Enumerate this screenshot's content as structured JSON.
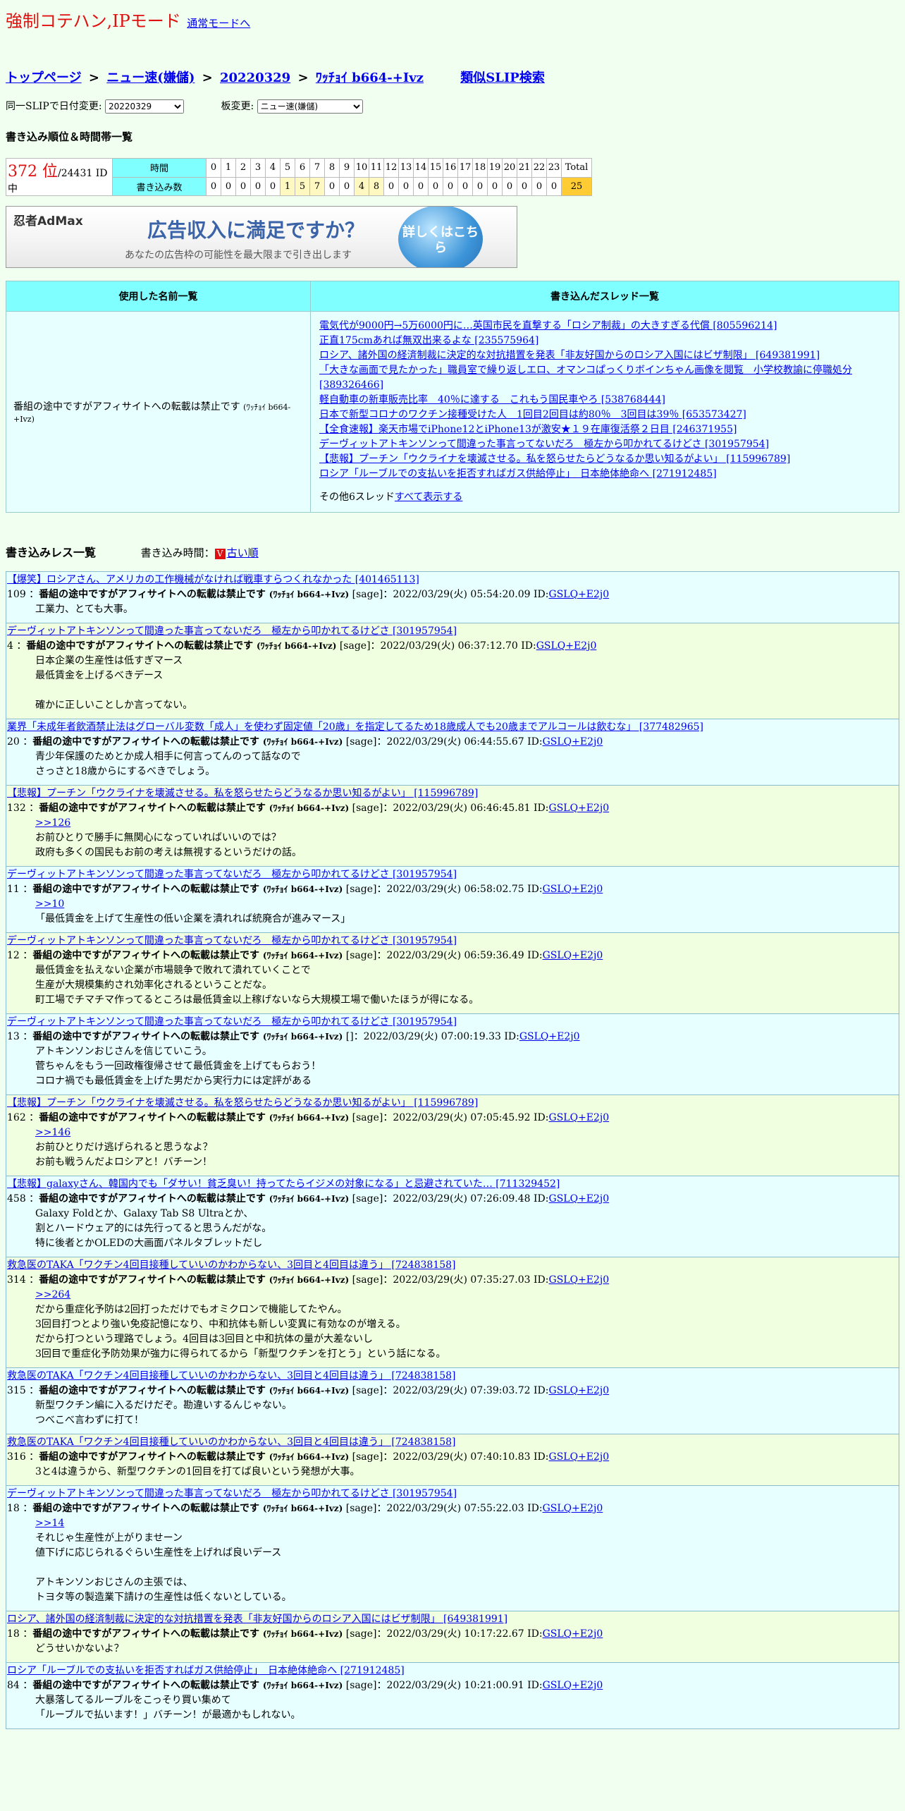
{
  "header": {
    "mode_title": "強制コテハン,IPモード",
    "normal_mode_link": "通常モードへ"
  },
  "breadcrumb": {
    "top": "トップページ",
    "board": "ニュー速(嫌儲)",
    "date": "20220329",
    "slip": "ﾜｯﾁｮｲ b664-+Ivz",
    "similar": "類似SLIP検索",
    "sep": ">"
  },
  "controls": {
    "date_change_label": "同一SLIPで日付変更:",
    "date_value": "20220329",
    "board_change_label": "板変更:",
    "board_value": "ニュー速(嫌儲)"
  },
  "ranking": {
    "heading": "書き込み順位＆時間帯一覧",
    "rank": "372 位",
    "id_total": "/24431 ID中",
    "time_label": "時間",
    "count_label": "書き込み数",
    "hours": [
      "0",
      "1",
      "2",
      "3",
      "4",
      "5",
      "6",
      "7",
      "8",
      "9",
      "10",
      "11",
      "12",
      "13",
      "14",
      "15",
      "16",
      "17",
      "18",
      "19",
      "20",
      "21",
      "22",
      "23",
      "Total"
    ],
    "counts": [
      "0",
      "0",
      "0",
      "0",
      "0",
      "1",
      "5",
      "7",
      "0",
      "0",
      "4",
      "8",
      "0",
      "0",
      "0",
      "0",
      "0",
      "0",
      "0",
      "0",
      "0",
      "0",
      "0",
      "0",
      "25"
    ]
  },
  "ad": {
    "logo": "忍者AdMax",
    "headline": "広告収入に満足ですか？",
    "sub": "あなたの広告枠の可能性を最大限まで引き出します",
    "button": "詳しくはこちら"
  },
  "usage": {
    "names_header": "使用した名前一覧",
    "threads_header": "書き込んだスレッド一覧",
    "name": "番組の途中ですがアフィサイトへの転載は禁止です",
    "name_slip": "(ﾜｯﾁｮｲ b664-+Ivz)",
    "threads": [
      "電気代が9000円→5万6000円に…英国市民を直撃する「ロシア制裁」の大きすぎる代償 [805596214]",
      "正直175cmあれば無双出来るよな [235575964]",
      "ロシア、諸外国の経済制裁に決定的な対抗措置を発表「非友好国からのロシア入国にはビザ制限」 [649381991]",
      "「大きな画面で見たかった」職員室で繰り返しエロ、オマンコぱっくりボインちゃん画像を閲覧　小学校教諭に停職処分 [389326466]",
      "軽自動車の新車販売比率　40％に達する　これもう国民車やろ [538768444]",
      "日本で新型コロナのワクチン接種受けた人　1回目2回目は約80％　3回目は39％ [653573427]",
      "【全食速報】楽天市場でiPhone12とiPhone13が激安★１９在庫復活祭２日目 [246371955]",
      "デーヴィットアトキンソンって間違った事言ってないだろ　極左から叩かれてるけどさ [301957954]",
      "【悲報】プーチン「ウクライナを壊滅させる。私を怒らせたらどうなるか思い知るがよい」 [115996789]",
      "ロシア「ルーブルでの支払いを拒否すればガス供給停止」　日本絶体絶命へ [271912485]"
    ],
    "more_prefix": "その他6スレッド",
    "more_link": "すべて表示する"
  },
  "posts_header": {
    "title": "書き込みレス一覧",
    "order_label": "書き込み時間：",
    "order_icon": "V",
    "order_link": "古い順"
  },
  "posts": [
    {
      "thread": "【爆笑】ロシアさん、アメリカの工作機械がなければ戦車すらつくれなかった [401465113]",
      "num": "109",
      "name": "番組の途中ですがアフィサイトへの転載は禁止です",
      "slip": "(ﾜｯﾁｮｲ b664-+Ivz)",
      "mail": "[sage]",
      "date": "：2022/03/29(火) 05:54:20.09",
      "id_label": "ID:",
      "id": "GSLQ+E2j0",
      "lines": [
        "工業力、とても大事。"
      ]
    },
    {
      "thread": "デーヴィットアトキンソンって間違った事言ってないだろ　極左から叩かれてるけどさ [301957954]",
      "num": "4",
      "name": "番組の途中ですがアフィサイトへの転載は禁止です",
      "slip": "(ﾜｯﾁｮｲ b664-+Ivz)",
      "mail": "[sage]",
      "date": "：2022/03/29(火) 06:37:12.70",
      "id_label": "ID:",
      "id": "GSLQ+E2j0",
      "lines": [
        "日本企業の生産性は低すぎマース",
        "最低賃金を上げるべきデース",
        "",
        "確かに正しいことしか言ってない。"
      ]
    },
    {
      "thread": "業界「未成年者飲酒禁止法はグローバル変数「成人」を使わず固定値「20歳」を指定してるため18歳成人でも20歳までアルコールは飲むな」 [377482965]",
      "num": "20",
      "name": "番組の途中ですがアフィサイトへの転載は禁止です",
      "slip": "(ﾜｯﾁｮｲ b664-+Ivz)",
      "mail": "[sage]",
      "date": "：2022/03/29(火) 06:44:55.67",
      "id_label": "ID:",
      "id": "GSLQ+E2j0",
      "lines": [
        "青少年保護のためとか成人相手に何言ってんのって話なので",
        "さっさと18歳からにするべきでしょう。"
      ]
    },
    {
      "thread": "【悲報】プーチン「ウクライナを壊滅させる。私を怒らせたらどうなるか思い知るがよい」 [115996789]",
      "num": "132",
      "name": "番組の途中ですがアフィサイトへの転載は禁止です",
      "slip": "(ﾜｯﾁｮｲ b664-+Ivz)",
      "mail": "[sage]",
      "date": "：2022/03/29(火) 06:46:45.81",
      "id_label": "ID:",
      "id": "GSLQ+E2j0",
      "anchor": ">>126",
      "lines": [
        "お前ひとりで勝手に無関心になっていればいいのでは？",
        "政府も多くの国民もお前の考えは無視するというだけの話。"
      ]
    },
    {
      "thread": "デーヴィットアトキンソンって間違った事言ってないだろ　極左から叩かれてるけどさ [301957954]",
      "num": "11",
      "name": "番組の途中ですがアフィサイトへの転載は禁止です",
      "slip": "(ﾜｯﾁｮｲ b664-+Ivz)",
      "mail": "[sage]",
      "date": "：2022/03/29(火) 06:58:02.75",
      "id_label": "ID:",
      "id": "GSLQ+E2j0",
      "anchor": ">>10",
      "lines": [
        "「最低賃金を上げて生産性の低い企業を潰れれば統廃合が進みマース」"
      ]
    },
    {
      "thread": "デーヴィットアトキンソンって間違った事言ってないだろ　極左から叩かれてるけどさ [301957954]",
      "num": "12",
      "name": "番組の途中ですがアフィサイトへの転載は禁止です",
      "slip": "(ﾜｯﾁｮｲ b664-+Ivz)",
      "mail": "[sage]",
      "date": "：2022/03/29(火) 06:59:36.49",
      "id_label": "ID:",
      "id": "GSLQ+E2j0",
      "lines": [
        "最低賃金を払えない企業が市場競争で敗れて潰れていくことで",
        "生産が大規模集約され効率化されるということだな。",
        "町工場でチマチマ作ってるところは最低賃金以上稼げないなら大規模工場で働いたほうが得になる。"
      ]
    },
    {
      "thread": "デーヴィットアトキンソンって間違った事言ってないだろ　極左から叩かれてるけどさ [301957954]",
      "num": "13",
      "name": "番組の途中ですがアフィサイトへの転載は禁止です",
      "slip": "(ﾜｯﾁｮｲ b664-+Ivz)",
      "mail": "[]",
      "date": "：2022/03/29(火) 07:00:19.33",
      "id_label": "ID:",
      "id": "GSLQ+E2j0",
      "lines": [
        "アトキンソンおじさんを信じていこう。",
        "菅ちゃんをもう一回政権復帰させて最低賃金を上げてもらおう！",
        "コロナ禍でも最低賃金を上げた男だから実行力には定評がある"
      ]
    },
    {
      "thread": "【悲報】プーチン「ウクライナを壊滅させる。私を怒らせたらどうなるか思い知るがよい」 [115996789]",
      "num": "162",
      "name": "番組の途中ですがアフィサイトへの転載は禁止です",
      "slip": "(ﾜｯﾁｮｲ b664-+Ivz)",
      "mail": "[sage]",
      "date": "：2022/03/29(火) 07:05:45.92",
      "id_label": "ID:",
      "id": "GSLQ+E2j0",
      "anchor": ">>146",
      "lines": [
        "お前ひとりだけ逃げられると思うなよ？",
        "お前も戦うんだよロシアと！バチーン！"
      ]
    },
    {
      "thread": "【悲報】galaxyさん、韓国内でも「ダサい！貧乏臭い！持ってたらイジメの対象になる」と忌避されていた… [711329452]",
      "num": "458",
      "name": "番組の途中ですがアフィサイトへの転載は禁止です",
      "slip": "(ﾜｯﾁｮｲ b664-+Ivz)",
      "mail": "[sage]",
      "date": "：2022/03/29(火) 07:26:09.48",
      "id_label": "ID:",
      "id": "GSLQ+E2j0",
      "lines": [
        "Galaxy Foldとか、Galaxy Tab S8 Ultraとか、",
        "割とハードウェア的には先行ってると思うんだがな。",
        "特に後者とかOLEDの大画面パネルタブレットだし"
      ]
    },
    {
      "thread": "救急医のTAKA「ワクチン4回目接種していいのかわからない、3回目と4回目は違う」 [724838158]",
      "num": "314",
      "name": "番組の途中ですがアフィサイトへの転載は禁止です",
      "slip": "(ﾜｯﾁｮｲ b664-+Ivz)",
      "mail": "[sage]",
      "date": "：2022/03/29(火) 07:35:27.03",
      "id_label": "ID:",
      "id": "GSLQ+E2j0",
      "anchor": ">>264",
      "lines": [
        "だから重症化予防は2回打っただけでもオミクロンで機能してたやん。",
        "3回目打つとより強い免疫記憶になり、中和抗体も新しい変異に有効なのが増える。",
        "だから打つという理路でしょう。4回目は3回目と中和抗体の量が大差ないし",
        "3回目で重症化予防効果が強力に得られてるから「新型ワクチンを打とう」という話になる。"
      ]
    },
    {
      "thread": "救急医のTAKA「ワクチン4回目接種していいのかわからない、3回目と4回目は違う」 [724838158]",
      "num": "315",
      "name": "番組の途中ですがアフィサイトへの転載は禁止です",
      "slip": "(ﾜｯﾁｮｲ b664-+Ivz)",
      "mail": "[sage]",
      "date": "：2022/03/29(火) 07:39:03.72",
      "id_label": "ID:",
      "id": "GSLQ+E2j0",
      "lines": [
        "新型ワクチン編に入るだけだぞ。勘違いするんじゃない。",
        "つべこべ言わずに打て！"
      ]
    },
    {
      "thread": "救急医のTAKA「ワクチン4回目接種していいのかわからない、3回目と4回目は違う」 [724838158]",
      "num": "316",
      "name": "番組の途中ですがアフィサイトへの転載は禁止です",
      "slip": "(ﾜｯﾁｮｲ b664-+Ivz)",
      "mail": "[sage]",
      "date": "：2022/03/29(火) 07:40:10.83",
      "id_label": "ID:",
      "id": "GSLQ+E2j0",
      "lines": [
        "3と4は違うから、新型ワクチンの1回目を打てば良いという発想が大事。"
      ]
    },
    {
      "thread": "デーヴィットアトキンソンって間違った事言ってないだろ　極左から叩かれてるけどさ [301957954]",
      "num": "18",
      "name": "番組の途中ですがアフィサイトへの転載は禁止です",
      "slip": "(ﾜｯﾁｮｲ b664-+Ivz)",
      "mail": "[sage]",
      "date": "：2022/03/29(火) 07:55:22.03",
      "id_label": "ID:",
      "id": "GSLQ+E2j0",
      "anchor": ">>14",
      "lines": [
        "それじゃ生産性が上がりませーン",
        "値下げに応じられるぐらい生産性を上げれば良いデース",
        "",
        "アトキンソンおじさんの主張では、",
        "トヨタ等の製造業下請けの生産性は低くないとしている。"
      ]
    },
    {
      "thread": "ロシア、諸外国の経済制裁に決定的な対抗措置を発表「非友好国からのロシア入国にはビザ制限」 [649381991]",
      "num": "18",
      "name": "番組の途中ですがアフィサイトへの転載は禁止です",
      "slip": "(ﾜｯﾁｮｲ b664-+Ivz)",
      "mail": "[sage]",
      "date": "：2022/03/29(火) 10:17:22.67",
      "id_label": "ID:",
      "id": "GSLQ+E2j0",
      "lines": [
        "どうせいかないよ？"
      ]
    },
    {
      "thread": "ロシア「ルーブルでの支払いを拒否すればガス供給停止」　日本絶体絶命へ [271912485]",
      "num": "84",
      "name": "番組の途中ですがアフィサイトへの転載は禁止です",
      "slip": "(ﾜｯﾁｮｲ b664-+Ivz)",
      "mail": "[sage]",
      "date": "：2022/03/29(火) 10:21:00.91",
      "id_label": "ID:",
      "id": "GSLQ+E2j0",
      "lines": [
        "大暴落してるルーブルをこっそり買い集めて",
        "「ルーブルで払います！」バチーン！が最適かもしれない。"
      ]
    }
  ]
}
